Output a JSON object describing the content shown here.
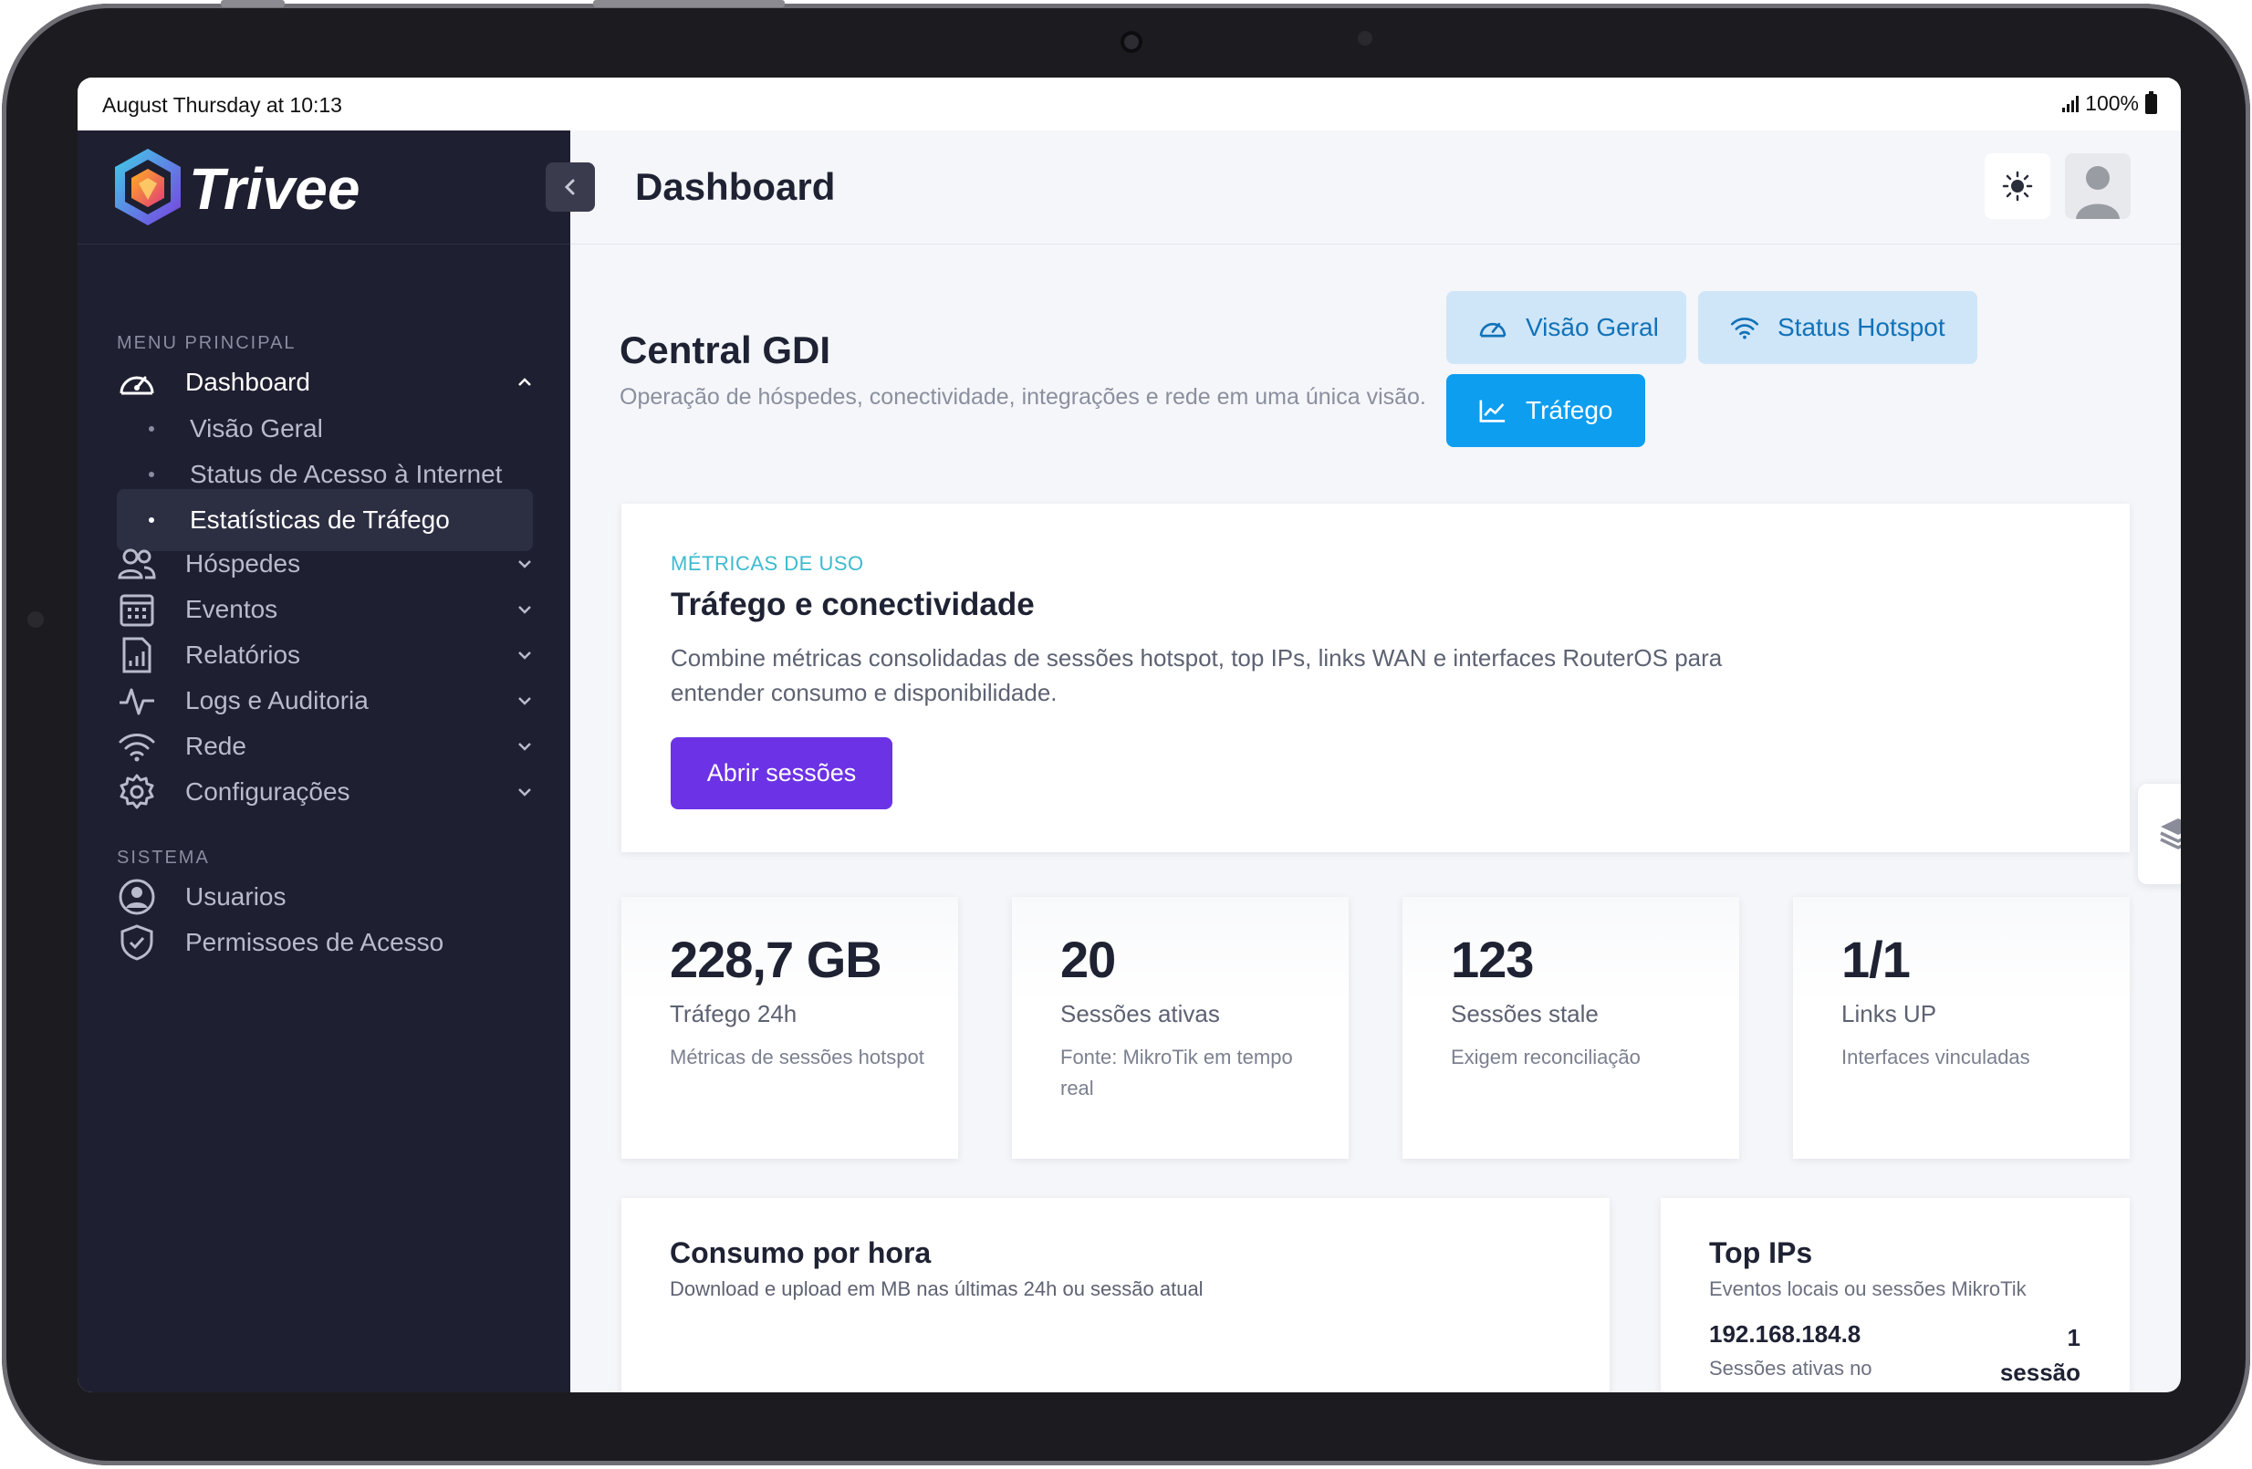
{
  "status_bar": {
    "time": "August Thursday at 10:13",
    "battery": "100%"
  },
  "brand": {
    "name": "Trivee"
  },
  "sidebar": {
    "section_main": "MENU PRINCIPAL",
    "dashboard": {
      "label": "Dashboard",
      "icon": "gauge-icon"
    },
    "subitems": [
      {
        "label": "Visão Geral"
      },
      {
        "label": "Status de Acesso à Internet"
      },
      {
        "label": "Estatísticas de Tráfego",
        "active": true
      }
    ],
    "items": [
      {
        "label": "Hóspedes",
        "icon": "users-icon"
      },
      {
        "label": "Eventos",
        "icon": "calendar-icon"
      },
      {
        "label": "Relatórios",
        "icon": "report-icon"
      },
      {
        "label": "Logs e Auditoria",
        "icon": "activity-icon"
      },
      {
        "label": "Rede",
        "icon": "wifi-icon"
      },
      {
        "label": "Configurações",
        "icon": "gear-icon"
      }
    ],
    "section_system": "SISTEMA",
    "system_items": [
      {
        "label": "Usuarios",
        "icon": "user-circle-icon"
      },
      {
        "label": "Permissoes de Acesso",
        "icon": "shield-icon"
      }
    ]
  },
  "header": {
    "title": "Dashboard"
  },
  "central": {
    "title": "Central GDI",
    "subtitle": "Operação de hóspedes, conectividade, integrações e rede em uma única visão.",
    "buttons": [
      {
        "label": "Visão Geral",
        "icon": "gauge-icon"
      },
      {
        "label": "Status Hotspot",
        "icon": "wifi-icon"
      },
      {
        "label": "Tráfego",
        "icon": "chart-line-icon"
      }
    ]
  },
  "hero": {
    "kicker": "MÉTRICAS DE USO",
    "title": "Tráfego e conectividade",
    "description": "Combine métricas consolidadas de sessões hotspot, top IPs, links WAN e interfaces RouterOS para entender consumo e disponibilidade.",
    "button": "Abrir sessões"
  },
  "stats": [
    {
      "value": "228,7 GB",
      "label": "Tráfego 24h",
      "desc": "Métricas de sessões hotspot"
    },
    {
      "value": "20",
      "label": "Sessões ativas",
      "desc": "Fonte: MikroTik em tempo real"
    },
    {
      "value": "123",
      "label": "Sessões stale",
      "desc": "Exigem reconciliação"
    },
    {
      "value": "1/1",
      "label": "Links UP",
      "desc": "Interfaces vinculadas"
    }
  ],
  "consumo": {
    "title": "Consumo por hora",
    "subtitle": "Download e upload em MB nas últimas 24h ou sessão atual"
  },
  "top_ips": {
    "title": "Top IPs",
    "subtitle": "Eventos locais ou sessões MikroTik",
    "rows": [
      {
        "ip": "192.168.184.8",
        "desc": "Sessões ativas no",
        "count": "1",
        "unit": "sessão"
      }
    ]
  },
  "colors": {
    "sidebar": "#1e1f30",
    "accent_purple": "#6c32e6",
    "accent_blue": "#0e9ef0",
    "kicker": "#3bbbd0"
  }
}
